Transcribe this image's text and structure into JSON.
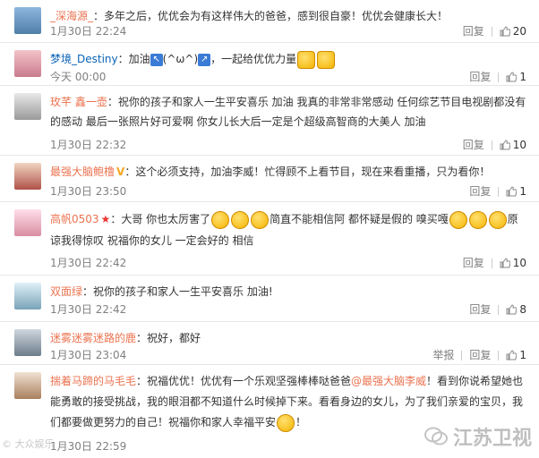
{
  "comments": [
    {
      "name": "_深海源_",
      "text": "：多年之后，优优会为有这样伟大的爸爸，感到很自豪！优优会健康长大！",
      "time": "1月30日 22:24",
      "reply": "回复",
      "likes": "20"
    },
    {
      "name": "梦境_Destiny",
      "text_parts": [
        "：加油",
        "(^ω^)",
        "，一起给优优力量"
      ],
      "time": "今天 00:00",
      "reply": "回复",
      "likes": "1"
    },
    {
      "name": "玫芊 鑫一壶",
      "text": "：祝你的孩子和家人一生平安喜乐 加油 我真的非常非常感动 任何综艺节目电视剧都没有的感动 最后一张照片好可爱啊 你女儿长大后一定是个超级高智商的大美人 加油",
      "time": "1月30日 22:32",
      "reply": "回复",
      "likes": "10"
    },
    {
      "name": "最强大脑鲍橹",
      "badge": "V",
      "text": "：这个必须支持，加油李威！忙得顾不上看节目，现在来看重播，只为看你！",
      "time": "1月30日 23:50",
      "reply": "回复",
      "likes": "1"
    },
    {
      "name": "高帆0503",
      "star": "★",
      "text_parts": [
        "：大哥 你也太厉害了",
        "简直不能相信阿 都怀疑是假的 嗅买嘎",
        "原谅我得惊叹 祝福你的女儿 一定会好的 相信"
      ],
      "time": "1月30日 22:42",
      "reply": "回复",
      "likes": "10"
    },
    {
      "name": "双面绿",
      "text": "：祝你的孩子和家人一生平安喜乐 加油!",
      "time": "1月30日 22:42",
      "reply": "回复",
      "likes": "8"
    },
    {
      "name": "迷雾迷雾迷路的鹿",
      "text": "：祝好，都好",
      "time": "1月30日 23:04",
      "report": "举报",
      "reply": "回复",
      "likes": "1"
    },
    {
      "name": "揣着马蹄的马毛毛",
      "text_parts": [
        "：祝福优优！优优有一个乐观坚强棒棒哒爸爸",
        "@最强大脑李威",
        "！看到你说希望她也能勇敢的接受挑战，我的眼泪都不知道什么时候掉下来。看看身边的女儿，为了我们亲爱的宝贝，我们都要做更努力的自己！祝福你和家人幸福平安",
        "！"
      ],
      "time": "1月30日 22:59",
      "reply": "回复",
      "likes": "1"
    }
  ],
  "watermark_left": "© 大众娱乐",
  "watermark_right": "江苏卫视"
}
